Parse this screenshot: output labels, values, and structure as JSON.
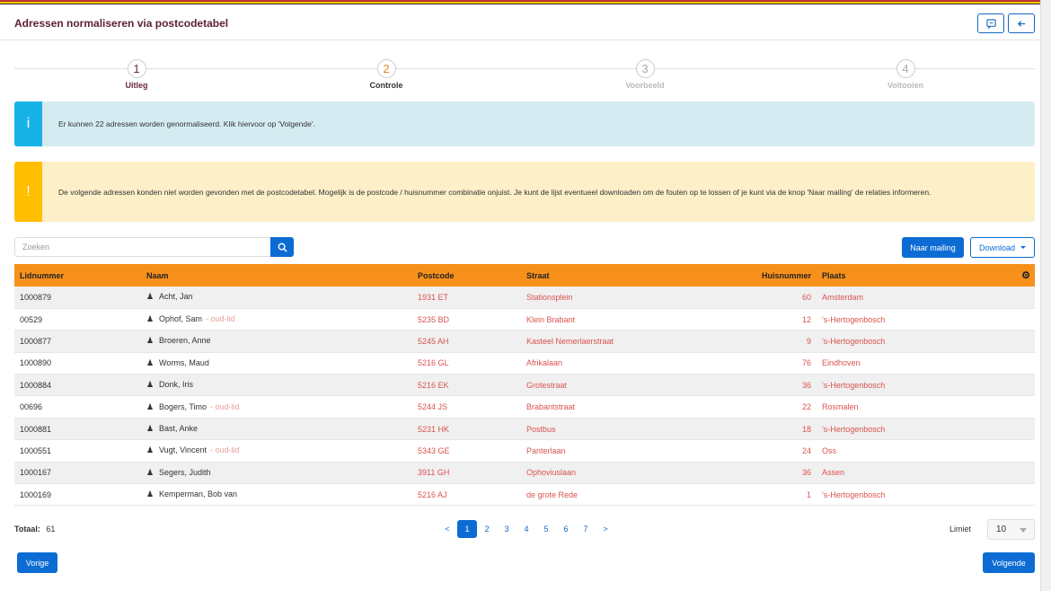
{
  "header": {
    "title": "Adressen normaliseren via postcodetabel"
  },
  "steps": [
    {
      "num": "1",
      "label": "Uitleg"
    },
    {
      "num": "2",
      "label": "Controle"
    },
    {
      "num": "3",
      "label": "Voorbeeld"
    },
    {
      "num": "4",
      "label": "Voltooien"
    }
  ],
  "info": {
    "icon": "i",
    "text": "Er kunnen 22 adressen worden genormaliseerd. Klik hiervoor op 'Volgende'."
  },
  "warning": {
    "icon": "!",
    "text": "De volgende adressen konden niet worden gevonden met de postcodetabel. Mogelijk is de postcode / huisnummer combinatie onjuist. Je kunt de lijst eventueel downloaden om de fouten op te lossen of je kunt via de knop 'Naar mailing' de relaties informeren."
  },
  "search": {
    "placeholder": "Zoeken"
  },
  "toolbar": {
    "mailing_label": "Naar mailing",
    "download_label": "Download"
  },
  "table": {
    "columns": [
      "Lidnummer",
      "Naam",
      "Postcode",
      "Straat",
      "Huisnummer",
      "Plaats"
    ],
    "rows": [
      {
        "lid": "1000879",
        "naam": "Acht, Jan",
        "oud": "",
        "postcode": "1931 ET",
        "straat": "Stationsplein",
        "huisnr": "60",
        "plaats": "Amsterdam"
      },
      {
        "lid": "00529",
        "naam": "Ophof, Sam",
        "oud": "- oud-lid",
        "postcode": "5235 BD",
        "straat": "Klein Brabant",
        "huisnr": "12",
        "plaats": "'s-Hertogenbosch"
      },
      {
        "lid": "1000877",
        "naam": "Broeren, Anne",
        "oud": "",
        "postcode": "5245 AH",
        "straat": "Kasteel Nemerlaerstraat",
        "huisnr": "9",
        "plaats": "'s-Hertogenbosch"
      },
      {
        "lid": "1000890",
        "naam": "Worms, Maud",
        "oud": "",
        "postcode": "5216 GL",
        "straat": "Afrikalaan",
        "huisnr": "76",
        "plaats": "Eindhoven"
      },
      {
        "lid": "1000884",
        "naam": "Donk, Iris",
        "oud": "",
        "postcode": "5216 EK",
        "straat": "Grotestraat",
        "huisnr": "36",
        "plaats": "'s-Hertogenbosch"
      },
      {
        "lid": "00696",
        "naam": "Bogers, Timo",
        "oud": "- oud-lid",
        "postcode": "5244 JS",
        "straat": "Brabantstraat",
        "huisnr": "22",
        "plaats": "Rosmalen"
      },
      {
        "lid": "1000881",
        "naam": "Bast, Anke",
        "oud": "",
        "postcode": "5231 HK",
        "straat": "Postbus",
        "huisnr": "18",
        "plaats": "'s-Hertogenbosch"
      },
      {
        "lid": "1000551",
        "naam": "Vugt, Vincent",
        "oud": "- oud-lid",
        "postcode": "5343 GE",
        "straat": "Panterlaan",
        "huisnr": "24",
        "plaats": "Oss"
      },
      {
        "lid": "1000167",
        "naam": "Segers, Judith",
        "oud": "",
        "postcode": "3911 GH",
        "straat": "Ophoviuslaan",
        "huisnr": "36",
        "plaats": "Assen"
      },
      {
        "lid": "1000169",
        "naam": "Kemperman, Bob van",
        "oud": "",
        "postcode": "5216 AJ",
        "straat": "de grote Rede",
        "huisnr": "1",
        "plaats": "'s-Hertogenbosch"
      }
    ]
  },
  "footer": {
    "totaal_label": "Totaal:",
    "totaal_value": "61",
    "pages": [
      "<",
      "1",
      "2",
      "3",
      "4",
      "5",
      "6",
      "7",
      ">"
    ],
    "active_page": "1",
    "limiet_label": "Limiet",
    "limiet_value": "10",
    "prev_label": "Vorige",
    "next_label": "Volgende"
  },
  "colors": {
    "accent": "#0d6cd4",
    "table_header": "#f7911c",
    "info": "#17b3e6",
    "warning": "#ffbe00",
    "error_text": "#d9534f"
  }
}
